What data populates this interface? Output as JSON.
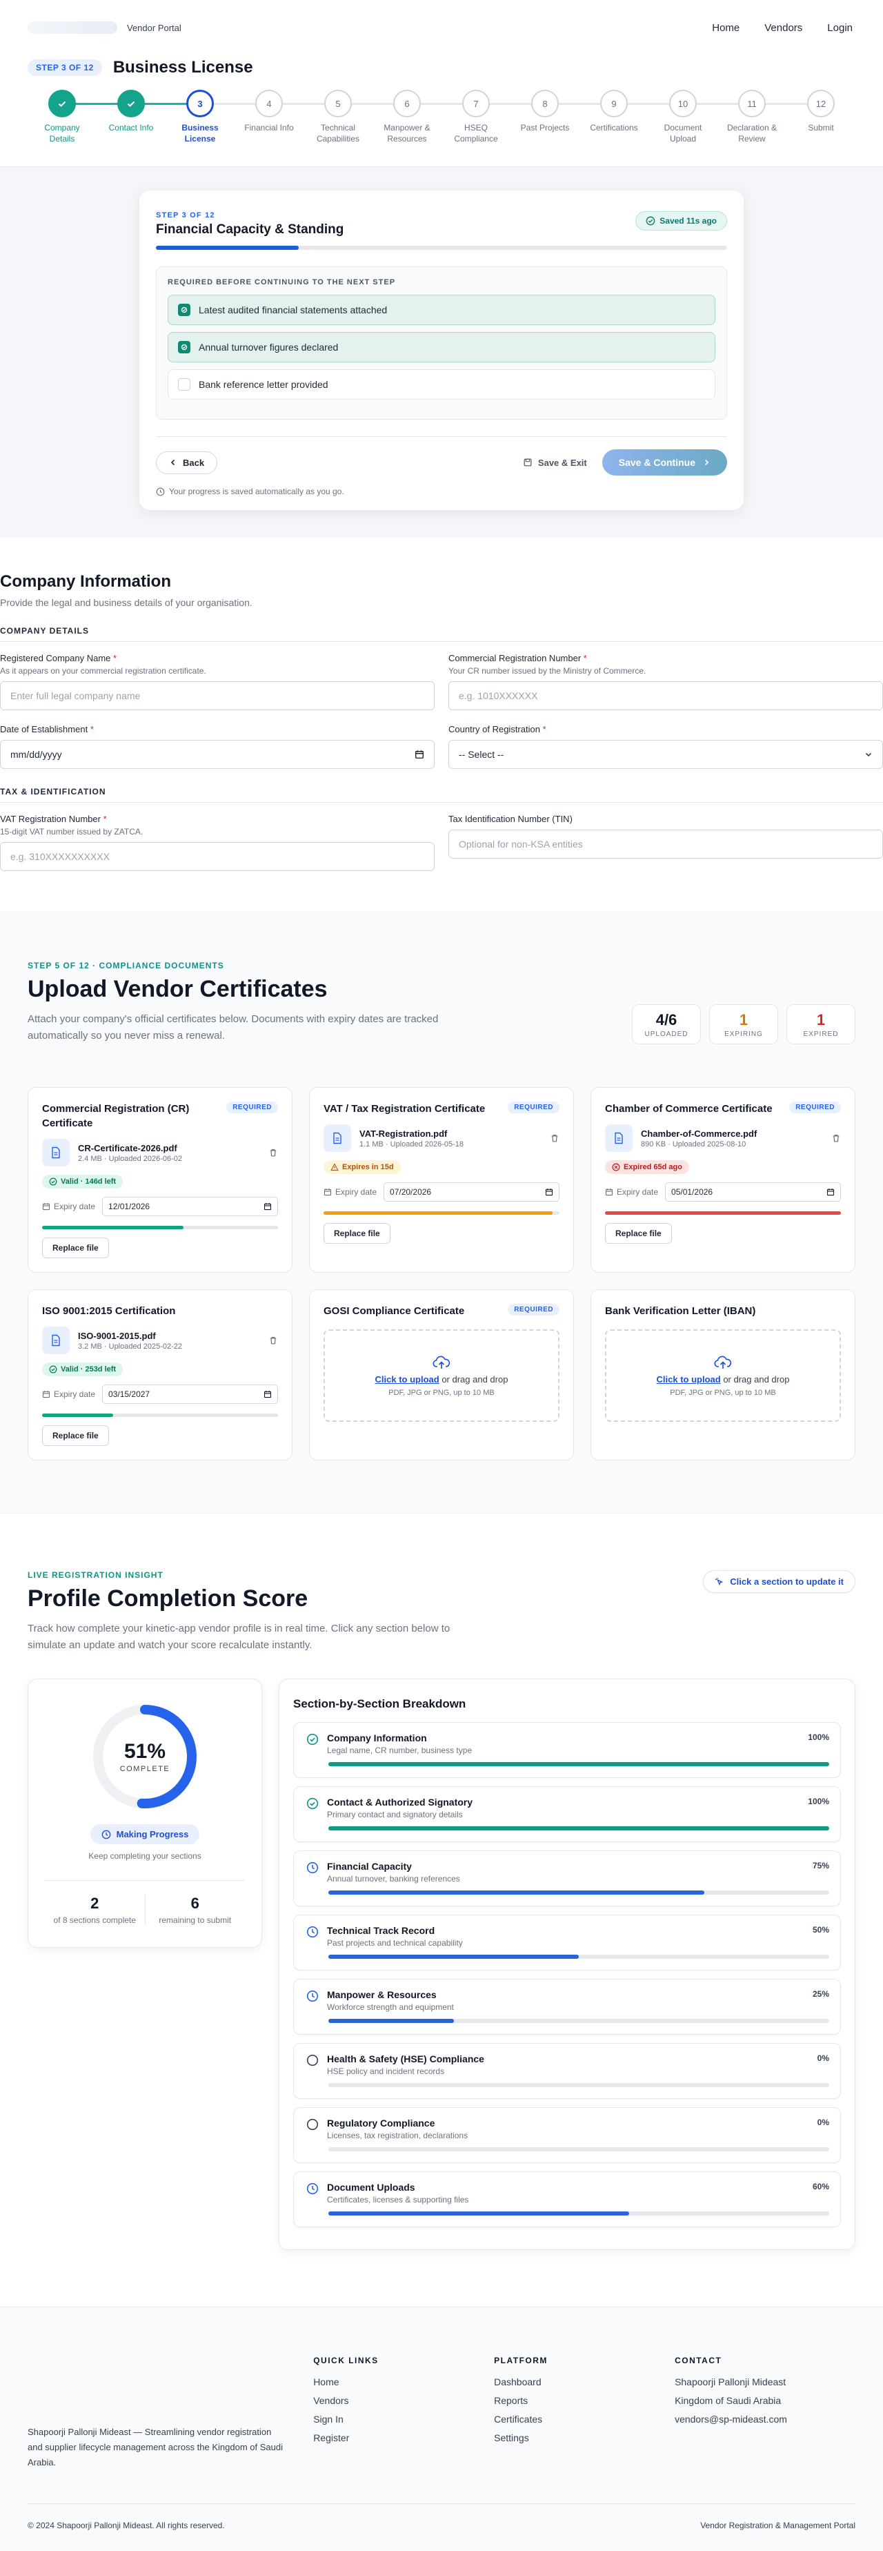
{
  "header": {
    "brand": "Vendor Portal",
    "nav": [
      "Home",
      "Vendors",
      "Login"
    ]
  },
  "stepper": {
    "pill": "STEP 3 OF 12",
    "title": "Business License",
    "steps": [
      {
        "n": "1",
        "label": "Company Details",
        "state": "done"
      },
      {
        "n": "2",
        "label": "Contact Info",
        "state": "done"
      },
      {
        "n": "3",
        "label": "Business License",
        "state": "current"
      },
      {
        "n": "4",
        "label": "Financial Info",
        "state": "todo"
      },
      {
        "n": "5",
        "label": "Technical Capabilities",
        "state": "todo"
      },
      {
        "n": "6",
        "label": "Manpower & Resources",
        "state": "todo"
      },
      {
        "n": "7",
        "label": "HSEQ Compliance",
        "state": "todo"
      },
      {
        "n": "8",
        "label": "Past Projects",
        "state": "todo"
      },
      {
        "n": "9",
        "label": "Certifications",
        "state": "todo"
      },
      {
        "n": "10",
        "label": "Document Upload",
        "state": "todo"
      },
      {
        "n": "11",
        "label": "Declaration & Review",
        "state": "todo"
      },
      {
        "n": "12",
        "label": "Submit",
        "state": "todo"
      }
    ]
  },
  "gate": {
    "eyebrow": "STEP 3 OF 12",
    "title": "Financial Capacity & Standing",
    "saved": "Saved 11s ago",
    "progress": 0.25,
    "required_heading": "REQUIRED BEFORE CONTINUING TO THE NEXT STEP",
    "items": [
      {
        "text": "Latest audited financial statements attached",
        "checked": true
      },
      {
        "text": "Annual turnover figures declared",
        "checked": true
      },
      {
        "text": "Bank reference letter provided",
        "checked": false
      }
    ],
    "back": "Back",
    "save_exit": "Save & Exit",
    "continue": "Save & Continue",
    "note": "Your progress is saved automatically as you go."
  },
  "company_form": {
    "title": "Company Information",
    "subtitle": "Provide the legal and business details of your organisation.",
    "section1": "COMPANY DETAILS",
    "section2": "TAX & IDENTIFICATION",
    "fields": {
      "name": {
        "label": "Registered Company Name",
        "help": "As it appears on your commercial registration certificate.",
        "placeholder": "Enter full legal company name"
      },
      "cr": {
        "label": "Commercial Registration Number",
        "help": "Your CR number issued by the Ministry of Commerce.",
        "placeholder": "e.g. 1010XXXXXX"
      },
      "doe": {
        "label": "Date of Establishment",
        "value": "mm/dd/yyyy"
      },
      "country": {
        "label": "Country of Registration",
        "value": "-- Select --"
      },
      "vat": {
        "label": "VAT Registration Number",
        "help": "15-digit VAT number issued by ZATCA.",
        "placeholder": "e.g. 310XXXXXXXXXX"
      },
      "tin": {
        "label": "Tax Identification Number (TIN)",
        "placeholder": "Optional for non-KSA entities"
      }
    }
  },
  "certs": {
    "eyebrow": "STEP 5 OF 12 · COMPLIANCE DOCUMENTS",
    "title": "Upload Vendor Certificates",
    "subtitle": "Attach your company's official certificates below. Documents with expiry dates are tracked automatically so you never miss a renewal.",
    "stats": [
      {
        "n": "4/6",
        "l": "UPLOADED",
        "color": "#111827"
      },
      {
        "n": "1",
        "l": "EXPIRING",
        "color": "#d97706"
      },
      {
        "n": "1",
        "l": "EXPIRED",
        "color": "#dc2626"
      }
    ],
    "required_label": "REQUIRED",
    "expiry_label": "Expiry date",
    "replace": "Replace file",
    "upload_link": "Click to upload",
    "upload_rest": " or drag and drop",
    "upload_hint": "PDF, JPG or PNG, up to 10 MB",
    "cards": [
      {
        "title": "Commercial Registration (CR) Certificate",
        "required": true,
        "file": "CR-Certificate-2026.pdf",
        "meta": "2.4 MB · Uploaded 2026-06-02",
        "status": "valid",
        "status_text": "Valid · 146d left",
        "date": "12/01/2026",
        "fill": 0.6,
        "color": "#10a37f"
      },
      {
        "title": "VAT / Tax Registration Certificate",
        "required": true,
        "file": "VAT-Registration.pdf",
        "meta": "1.1 MB · Uploaded 2026-05-18",
        "status": "expiring",
        "status_text": "Expires in 15d",
        "date": "07/20/2026",
        "fill": 0.97,
        "color": "#f59e0b"
      },
      {
        "title": "Chamber of Commerce Certificate",
        "required": true,
        "file": "Chamber-of-Commerce.pdf",
        "meta": "890 KB · Uploaded 2025-08-10",
        "status": "expired",
        "status_text": "Expired 65d ago",
        "date": "05/01/2026",
        "fill": 1.0,
        "color": "#ef4444"
      },
      {
        "title": "ISO 9001:2015 Certification",
        "required": false,
        "file": "ISO-9001-2015.pdf",
        "meta": "3.2 MB · Uploaded 2025-02-22",
        "status": "valid",
        "status_text": "Valid · 253d left",
        "date": "03/15/2027",
        "fill": 0.3,
        "color": "#10a37f"
      },
      {
        "title": "GOSI Compliance Certificate",
        "required": true,
        "file": null
      },
      {
        "title": "Bank Verification Letter (IBAN)",
        "required": false,
        "file": null
      }
    ]
  },
  "score": {
    "eyebrow": "LIVE REGISTRATION INSIGHT",
    "title": "Profile Completion Score",
    "subtitle": "Track how complete your kinetic-app vendor profile is in real time. Click any section below to simulate an update and watch your score recalculate instantly.",
    "pill": "Click a section to update it",
    "percent": 51,
    "percent_text": "51%",
    "complete": "COMPLETE",
    "status": "Making Progress",
    "keep": "Keep completing your sections",
    "done_n": "2",
    "done_l": "of 8 sections complete",
    "rem_n": "6",
    "rem_l": "remaining to submit",
    "breakdown_title": "Section-by-Section Breakdown",
    "sections": [
      {
        "name": "Company Information",
        "desc": "Legal name, CR number, business type",
        "pct": "100%",
        "value": 100,
        "state": "done"
      },
      {
        "name": "Contact & Authorized Signatory",
        "desc": "Primary contact and signatory details",
        "pct": "100%",
        "value": 100,
        "state": "done"
      },
      {
        "name": "Financial Capacity",
        "desc": "Annual turnover, banking references",
        "pct": "75%",
        "value": 75,
        "state": "progress"
      },
      {
        "name": "Technical Track Record",
        "desc": "Past projects and technical capability",
        "pct": "50%",
        "value": 50,
        "state": "progress"
      },
      {
        "name": "Manpower & Resources",
        "desc": "Workforce strength and equipment",
        "pct": "25%",
        "value": 25,
        "state": "progress"
      },
      {
        "name": "Health & Safety (HSE) Compliance",
        "desc": "HSE policy and incident records",
        "pct": "0%",
        "value": 0,
        "state": "empty"
      },
      {
        "name": "Regulatory Compliance",
        "desc": "Licenses, tax registration, declarations",
        "pct": "0%",
        "value": 0,
        "state": "empty"
      },
      {
        "name": "Document Uploads",
        "desc": "Certificates, licenses & supporting files",
        "pct": "60%",
        "value": 60,
        "state": "progress"
      }
    ]
  },
  "footer": {
    "about": "Shapoorji Pallonji Mideast — Streamlining vendor registration and supplier lifecycle management across the Kingdom of Saudi Arabia.",
    "quick_title": "QUICK LINKS",
    "quick": [
      "Home",
      "Vendors",
      "Sign In",
      "Register"
    ],
    "platform_title": "PLATFORM",
    "platform": [
      "Dashboard",
      "Reports",
      "Certificates",
      "Settings"
    ],
    "contact_title": "CONTACT",
    "contact": [
      "Shapoorji Pallonji Mideast",
      "Kingdom of Saudi Arabia",
      "vendors@sp-mideast.com"
    ],
    "copyright": "© 2024 Shapoorji Pallonji Mideast. All rights reserved.",
    "tagline": "Vendor Registration & Management Portal"
  }
}
